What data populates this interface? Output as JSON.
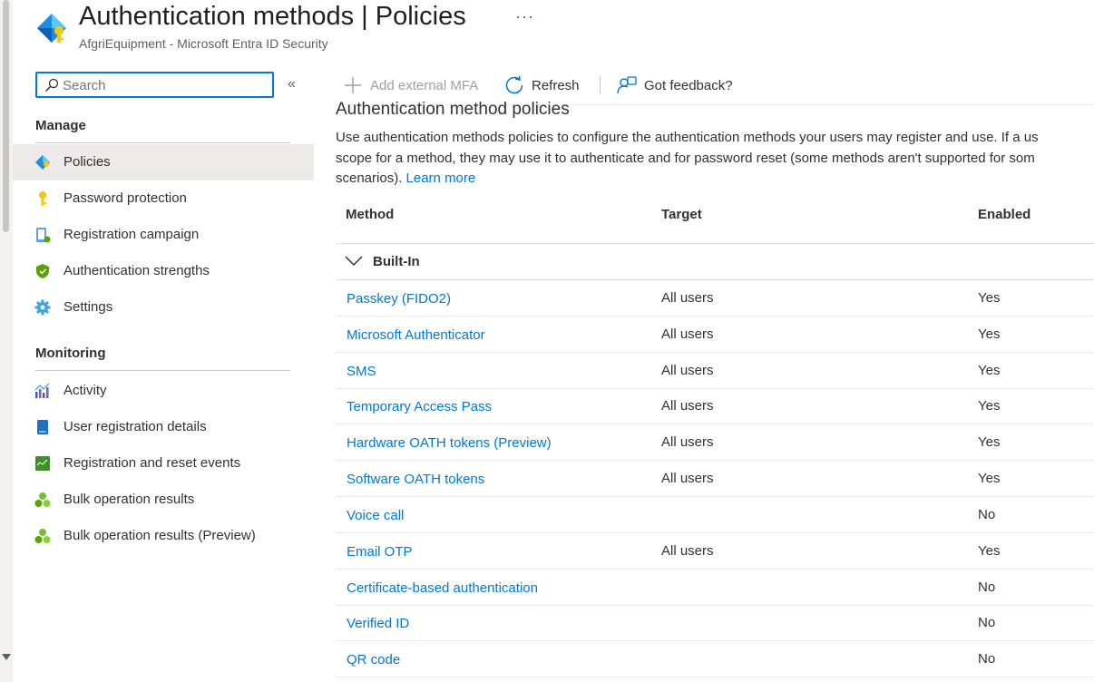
{
  "header": {
    "title": "Authentication methods",
    "separator": "|",
    "title_suffix": "Policies",
    "more": "···",
    "subtitle": "AfgriEquipment - Microsoft Entra ID Security"
  },
  "sidebar": {
    "search_placeholder": "Search",
    "collapse": "«",
    "sections": [
      {
        "heading": "Manage",
        "items": [
          {
            "label": "Policies",
            "icon": "policies-icon",
            "selected": true
          },
          {
            "label": "Password protection",
            "icon": "key-icon"
          },
          {
            "label": "Registration campaign",
            "icon": "registration-campaign-icon"
          },
          {
            "label": "Authentication strengths",
            "icon": "shield-icon"
          },
          {
            "label": "Settings",
            "icon": "gear-icon"
          }
        ]
      },
      {
        "heading": "Monitoring",
        "items": [
          {
            "label": "Activity",
            "icon": "activity-chart-icon"
          },
          {
            "label": "User registration details",
            "icon": "user-details-icon"
          },
          {
            "label": "Registration and reset events",
            "icon": "events-icon"
          },
          {
            "label": "Bulk operation results",
            "icon": "bulk-operations-icon"
          },
          {
            "label": "Bulk operation results (Preview)",
            "icon": "bulk-operations-icon"
          }
        ]
      }
    ]
  },
  "toolbar": {
    "add_external_mfa": "Add external MFA",
    "refresh": "Refresh",
    "feedback": "Got feedback?"
  },
  "main": {
    "heading": "Authentication method policies",
    "description_line1": "Use authentication methods policies to configure the authentication methods your users may register and use. If a us",
    "description_line2": "scope for a method, they may use it to authenticate and for password reset (some methods aren't supported for som",
    "description_line3": "scenarios).",
    "learn_more": "Learn more"
  },
  "table": {
    "columns": [
      "Method",
      "Target",
      "Enabled"
    ],
    "group": "Built-In",
    "rows": [
      {
        "method": "Passkey (FIDO2)",
        "target": "All users",
        "enabled": "Yes"
      },
      {
        "method": "Microsoft Authenticator",
        "target": "All users",
        "enabled": "Yes"
      },
      {
        "method": "SMS",
        "target": "All users",
        "enabled": "Yes"
      },
      {
        "method": "Temporary Access Pass",
        "target": "All users",
        "enabled": "Yes"
      },
      {
        "method": "Hardware OATH tokens (Preview)",
        "target": "All users",
        "enabled": "Yes"
      },
      {
        "method": "Software OATH tokens",
        "target": "All users",
        "enabled": "Yes"
      },
      {
        "method": "Voice call",
        "target": "",
        "enabled": "No"
      },
      {
        "method": "Email OTP",
        "target": "All users",
        "enabled": "Yes"
      },
      {
        "method": "Certificate-based authentication",
        "target": "",
        "enabled": "No"
      },
      {
        "method": "Verified ID",
        "target": "",
        "enabled": "No"
      },
      {
        "method": "QR code",
        "target": "",
        "enabled": "No"
      }
    ]
  },
  "colors": {
    "accent": "#0078d4",
    "selected_bg": "#edebe9",
    "text": "#323130",
    "muted": "#605e5c"
  }
}
